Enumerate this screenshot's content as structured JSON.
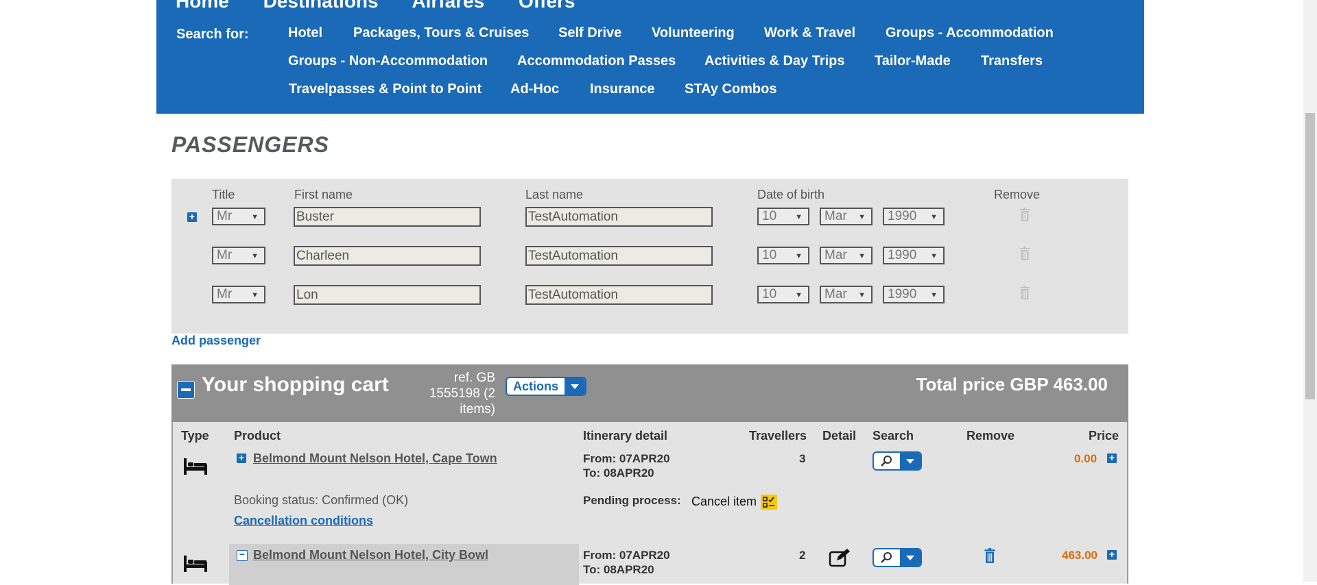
{
  "nav": {
    "main_links": [
      "Home",
      "Destinations",
      "Airfares",
      "Offers"
    ],
    "search_for_label": "Search for:",
    "services": [
      "Hotel",
      "Packages, Tours & Cruises",
      "Self Drive",
      "Volunteering",
      "Work & Travel",
      "Groups - Accommodation",
      "Groups - Non-Accommodation",
      "Accommodation Passes",
      "Activities & Day Trips",
      "Tailor-Made",
      "Transfers",
      "Travelpasses & Point to Point",
      "Ad-Hoc",
      "Insurance",
      "STAy Combos"
    ]
  },
  "passengers": {
    "heading": "PASSENGERS",
    "columns": {
      "title": "Title",
      "first_name": "First name",
      "last_name": "Last name",
      "dob": "Date of birth",
      "remove": "Remove"
    },
    "rows": [
      {
        "title": "Mr",
        "first": "Buster",
        "last": "TestAutomation",
        "day": "10",
        "month": "Mar",
        "year": "1990"
      },
      {
        "title": "Mr",
        "first": "Charleen",
        "last": "TestAutomation",
        "day": "10",
        "month": "Mar",
        "year": "1990"
      },
      {
        "title": "Mr",
        "first": "Lon",
        "last": "TestAutomation",
        "day": "10",
        "month": "Mar",
        "year": "1990"
      }
    ],
    "add_passenger": "Add passenger"
  },
  "cart": {
    "title": "Your shopping cart",
    "ref_lines": [
      "ref. GB",
      "1555198 (2",
      "items)"
    ],
    "actions_label": "Actions",
    "total_label": "Total price",
    "total_value": "GBP 463.00",
    "headers": {
      "type": "Type",
      "product": "Product",
      "itinerary": "Itinerary detail",
      "travellers": "Travellers",
      "detail": "Detail",
      "search": "Search",
      "remove": "Remove",
      "price": "Price"
    },
    "items": [
      {
        "product": "Belmond Mount Nelson Hotel, Cape Town",
        "from": "From: 07APR20",
        "to": "To: 08APR20",
        "travellers": "3",
        "price": "0.00",
        "booking_status": "Booking status: Confirmed (OK)",
        "pending_label": "Pending process:",
        "pending_value": "Cancel item",
        "cancellation_link": "Cancellation conditions"
      },
      {
        "product": "Belmond Mount Nelson Hotel, City Bowl",
        "from": "From: 07APR20",
        "to": "To: 08APR20",
        "travellers": "2",
        "price": "463.00"
      }
    ]
  },
  "colors": {
    "brand_blue": "#1a6ab7",
    "cart_bar": "#909090",
    "price_orange": "#d96b0c",
    "row_bg": "#e3e3e3"
  }
}
